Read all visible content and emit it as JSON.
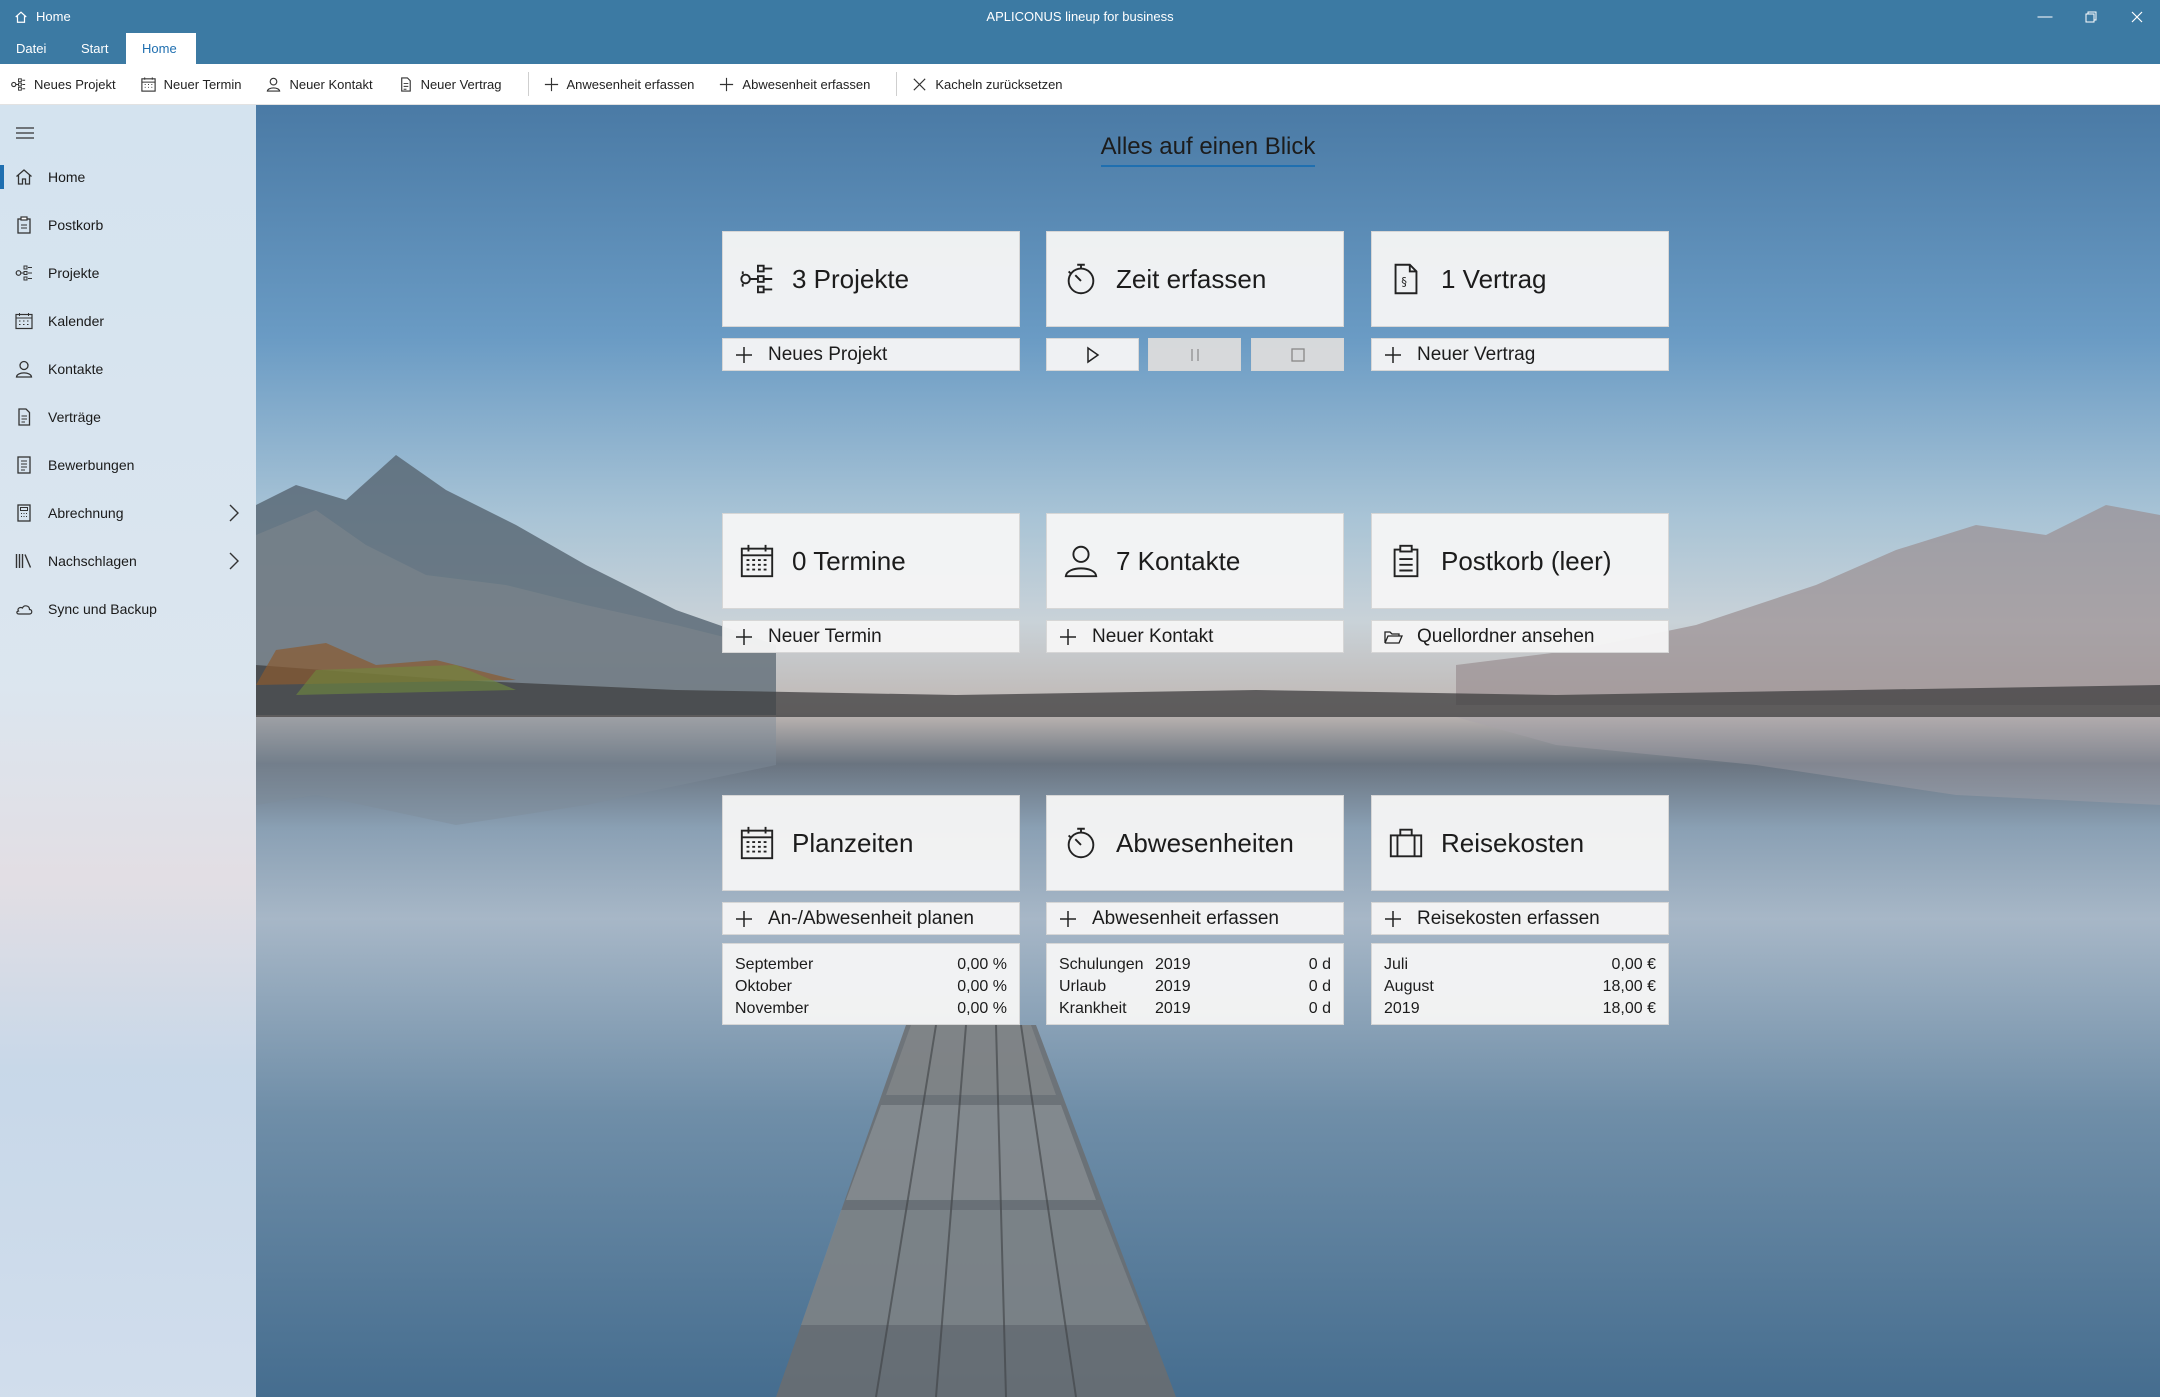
{
  "titlebar": {
    "tab_label": "Home",
    "app_title": "APLICONUS lineup for business"
  },
  "menu": {
    "tabs": [
      "Datei",
      "Start",
      "Home"
    ],
    "active": "Home"
  },
  "toolbar": {
    "new_project": "Neues Projekt",
    "new_appointment": "Neuer Termin",
    "new_contact": "Neuer Kontakt",
    "new_contract": "Neuer Vertrag",
    "record_presence": "Anwesenheit erfassen",
    "record_absence": "Abwesenheit erfassen",
    "reset_tiles": "Kacheln zurücksetzen"
  },
  "sidebar": {
    "items": [
      {
        "label": "Home",
        "icon": "home-icon"
      },
      {
        "label": "Postkorb",
        "icon": "inbox-icon"
      },
      {
        "label": "Projekte",
        "icon": "projects-icon"
      },
      {
        "label": "Kalender",
        "icon": "calendar-icon"
      },
      {
        "label": "Kontakte",
        "icon": "contact-icon"
      },
      {
        "label": "Verträge",
        "icon": "contract-icon"
      },
      {
        "label": "Bewerbungen",
        "icon": "application-icon"
      },
      {
        "label": "Abrechnung",
        "icon": "calculator-icon"
      },
      {
        "label": "Nachschlagen",
        "icon": "library-icon"
      },
      {
        "label": "Sync und Backup",
        "icon": "cloud-icon"
      }
    ]
  },
  "main": {
    "headline": "Alles auf einen Blick",
    "tiles": {
      "projects": {
        "title": "3 Projekte",
        "action": "Neues Projekt"
      },
      "time": {
        "title": "Zeit erfassen"
      },
      "contract": {
        "title": "1 Vertrag",
        "action": "Neuer Vertrag"
      },
      "appointments": {
        "title": "0 Termine",
        "action": "Neuer Termin"
      },
      "contacts": {
        "title": "7 Kontakte",
        "action": "Neuer Kontakt"
      },
      "inbox": {
        "title": "Postkorb (leer)",
        "action": "Quellordner ansehen"
      },
      "planning": {
        "title": "Planzeiten",
        "action": "An-/Abwesenheit planen",
        "rows": [
          {
            "label": "September",
            "value": "0,00 %"
          },
          {
            "label": "Oktober",
            "value": "0,00 %"
          },
          {
            "label": "November",
            "value": "0,00 %"
          }
        ]
      },
      "absences": {
        "title": "Abwesenheiten",
        "action": "Abwesenheit erfassen",
        "rows": [
          {
            "label": "Schulungen",
            "year": "2019",
            "value": "0 d"
          },
          {
            "label": "Urlaub",
            "year": "2019",
            "value": "0 d"
          },
          {
            "label": "Krankheit",
            "year": "2019",
            "value": "0 d"
          }
        ]
      },
      "travel": {
        "title": "Reisekosten",
        "action": "Reisekosten erfassen",
        "rows": [
          {
            "label": "Juli",
            "value": "0,00 €"
          },
          {
            "label": "August",
            "value": "18,00 €"
          },
          {
            "label": "2019",
            "value": "18,00 €"
          }
        ]
      }
    }
  },
  "colors": {
    "accent": "#1f6fb0",
    "titlebar": "#3c7aa3"
  }
}
